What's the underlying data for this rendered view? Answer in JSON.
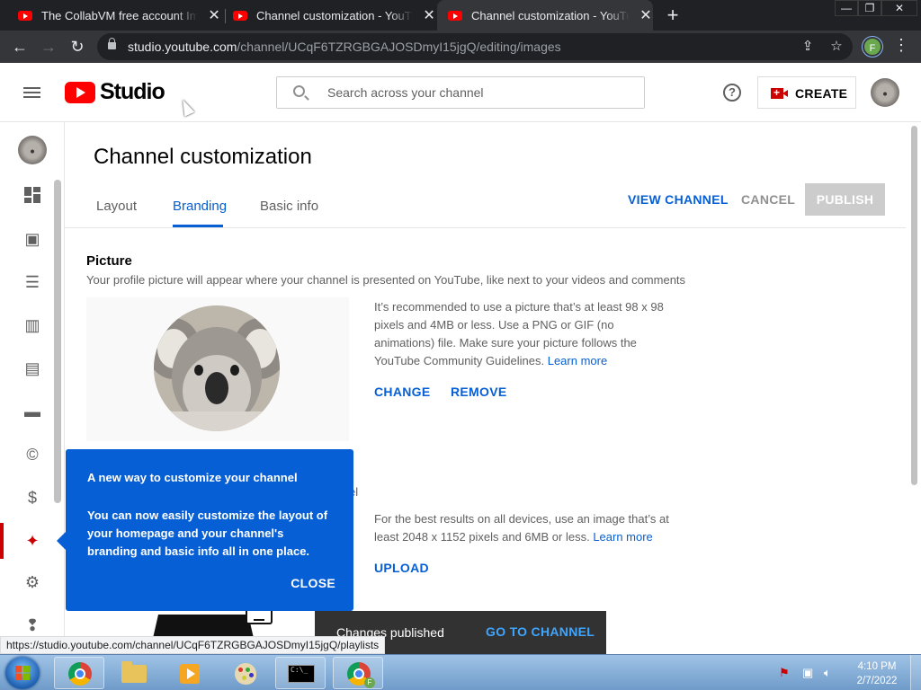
{
  "browser": {
    "tabs": [
      {
        "title": "The CollabVM free account Imag",
        "active": false
      },
      {
        "title": "Channel customization - YouTube",
        "active": false
      },
      {
        "title": "Channel customization - YouTube",
        "active": true
      }
    ],
    "url_host": "studio.youtube.com",
    "url_path": "/channel/UCqF6TZRGBGAJOSDmyI15jgQ/editing/images",
    "profile_initial": "F"
  },
  "header": {
    "logo_text": "Studio",
    "search_placeholder": "Search across your channel",
    "help_icon": "?",
    "create_label": "CREATE"
  },
  "sidebar": {
    "items": [
      {
        "name": "dashboard",
        "icon": "dashboard-icon"
      },
      {
        "name": "content",
        "icon": "video-content-icon"
      },
      {
        "name": "playlists",
        "icon": "playlists-icon"
      },
      {
        "name": "analytics",
        "icon": "analytics-icon"
      },
      {
        "name": "comments",
        "icon": "comments-icon"
      },
      {
        "name": "subtitles",
        "icon": "subtitles-icon"
      },
      {
        "name": "copyright",
        "icon": "copyright-icon"
      },
      {
        "name": "monetization",
        "icon": "dollar-icon"
      },
      {
        "name": "customization",
        "icon": "magic-wand-icon",
        "active": true
      },
      {
        "name": "settings",
        "icon": "gear-icon"
      },
      {
        "name": "feedback",
        "icon": "feedback-icon"
      }
    ]
  },
  "page": {
    "title": "Channel customization",
    "tabs": [
      {
        "label": "Layout",
        "active": false
      },
      {
        "label": "Branding",
        "active": true
      },
      {
        "label": "Basic info",
        "active": false
      }
    ],
    "view_channel_label": "VIEW CHANNEL",
    "cancel_label": "CANCEL",
    "publish_label": "PUBLISH"
  },
  "picture": {
    "title": "Picture",
    "description": "Your profile picture will appear where your channel is presented on YouTube, like next to your videos and comments",
    "guideline": "It’s recommended to use a picture that’s at least 98 x 98 pixels and 4MB or less. Use a PNG or GIF (no animations) file. Make sure your picture follows the YouTube Community Guidelines.",
    "learn_more": "Learn more",
    "change_label": "CHANGE",
    "remove_label": "REMOVE"
  },
  "banner": {
    "fragment": "el",
    "guideline": "For the best results on all devices, use an image that’s at least 2048 x 1152 pixels and 6MB or less.",
    "learn_more": "Learn more",
    "upload_label": "UPLOAD"
  },
  "popup": {
    "title": "A new way to customize your channel",
    "body": "You can now easily customize the layout of your homepage and your channel's branding and basic info all in one place.",
    "close_label": "CLOSE"
  },
  "snackbar": {
    "message": "Changes published",
    "action_label": "GO TO CHANNEL"
  },
  "status_url": "https://studio.youtube.com/channel/UCqF6TZRGBGAJOSDmyI15jgQ/playlists",
  "taskbar": {
    "time": "4:10 PM",
    "date": "2/7/2022",
    "chrome_badge": "F",
    "cmd_text": "C:\\_"
  },
  "colors": {
    "accent_blue": "#065fd4",
    "youtube_red": "#ff0000",
    "active_red": "#cc0000"
  }
}
